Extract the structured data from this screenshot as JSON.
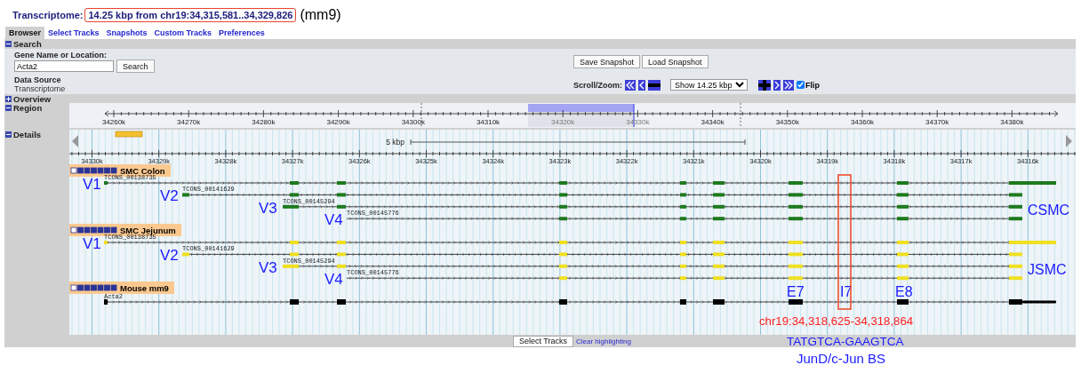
{
  "header": {
    "source": "Transcriptome:",
    "location": "14.25 kbp from chr19:34,315,581..34,329,826",
    "assembly": "(mm9)"
  },
  "tabs": [
    {
      "label": "Browser",
      "selected": true
    },
    {
      "label": "Select Tracks",
      "selected": false
    },
    {
      "label": "Snapshots",
      "selected": false
    },
    {
      "label": "Custom Tracks",
      "selected": false
    },
    {
      "label": "Preferences",
      "selected": false
    }
  ],
  "search": {
    "title": "Search",
    "expanded": true,
    "field_label": "Gene Name or Location:",
    "value": "Acta2",
    "button": "Search",
    "data_source_label": "Data Source",
    "data_source": "Transcriptome"
  },
  "snapshot_buttons": [
    "Save Snapshot",
    "Load Snapshot"
  ],
  "scroll_zoom": {
    "label": "Scroll/Zoom:",
    "zoom_select": "Show 14.25 kbp",
    "flip": {
      "label": "Flip",
      "checked": true
    }
  },
  "overview": {
    "title": "Overview",
    "expanded": false
  },
  "region": {
    "title": "Region",
    "expanded": true,
    "ticks": [
      "34260k",
      "34270k",
      "34280k",
      "34290k",
      "34300k",
      "34310k",
      "34320k",
      "34330k",
      "34340k",
      "34350k",
      "34360k",
      "34370k",
      "34380k"
    ]
  },
  "details": {
    "title": "Details",
    "expanded": true,
    "scale_label": "5 kbp",
    "ticks": [
      "34330k",
      "34329k",
      "34328k",
      "34327k",
      "34326k",
      "34325k",
      "34324k",
      "34323k",
      "34322k",
      "34321k",
      "34320k",
      "34319k",
      "34318k",
      "34317k",
      "34316k"
    ],
    "tracks": [
      {
        "title": "SMC Colon",
        "kind": "assembled",
        "color": "#1e7a1e",
        "group_label": "CSMC",
        "transcripts": [
          {
            "name": "TCONS_00138735",
            "label": "V1"
          },
          {
            "name": "TCONS_00141629",
            "label": "V2"
          },
          {
            "name": "TCONS_00145294",
            "label": "V3"
          },
          {
            "name": "TCONS_00145776",
            "label": "V4"
          }
        ]
      },
      {
        "title": "SMC Jejunum",
        "kind": "assembled",
        "color": "#f0e020",
        "group_label": "JSMC",
        "transcripts": [
          {
            "name": "TCONS_00138735",
            "label": "V1"
          },
          {
            "name": "TCONS_00141629",
            "label": "V2"
          },
          {
            "name": "TCONS_00145294",
            "label": "V3"
          },
          {
            "name": "TCONS_00145776",
            "label": "V4"
          }
        ]
      },
      {
        "title": "Mouse mm9",
        "kind": "reference",
        "color": "#000000",
        "transcripts": [
          {
            "name": "Acta2"
          }
        ]
      }
    ]
  },
  "footer": {
    "select_button": "Select Tracks",
    "clear_link": "Clear highlighting"
  },
  "annotations": {
    "features": [
      "E7",
      "I7",
      "E8"
    ],
    "site_coordinates": "chr19:34,318,625-34,318,864",
    "site_sequence": "TATGTCA-GAAGTCA",
    "site_name": "JunD/c-Jun BS"
  }
}
